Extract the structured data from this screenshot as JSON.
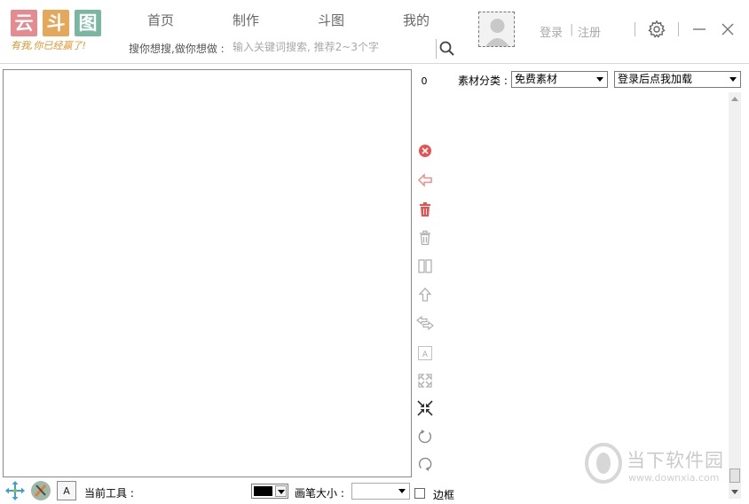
{
  "logo": {
    "chars": [
      "云",
      "斗",
      "图"
    ],
    "colors": [
      "#e58a8e",
      "#e5a85b",
      "#7ab7a3"
    ],
    "slogan": "有我,你已经赢了!"
  },
  "nav": {
    "tabs": [
      "首页",
      "制作",
      "斗图",
      "我的"
    ]
  },
  "search": {
    "label": "搜你想搜,做你想做 :",
    "placeholder": "输入关键词搜索, 推荐2~3个字",
    "icon": "search-icon"
  },
  "account": {
    "login": "登录",
    "separator": "|",
    "register": "注册"
  },
  "window_controls": {
    "settings_icon": "gear-icon",
    "minimize_icon": "minimize-icon",
    "close_icon": "close-icon"
  },
  "toolbar": {
    "count": "0",
    "tools": [
      {
        "name": "delete-red-icon",
        "color": "#e95050"
      },
      {
        "name": "undo-arrow-icon",
        "color": "#f08c8c"
      },
      {
        "name": "trash-red-icon",
        "color": "#e95050"
      },
      {
        "name": "trash-icon",
        "color": "#b0b0b0"
      },
      {
        "name": "split-icon",
        "color": "#b0b0b0"
      },
      {
        "name": "arrow-up-icon",
        "color": "#b0b0b0"
      },
      {
        "name": "swap-icon",
        "color": "#b0b0b0"
      },
      {
        "name": "text-box-icon",
        "color": "#b0b0b0"
      },
      {
        "name": "expand-icon",
        "color": "#b0b0b0"
      },
      {
        "name": "shrink-icon",
        "color": "#333333"
      },
      {
        "name": "rotate-right-icon",
        "color": "#8a8a8a"
      },
      {
        "name": "rotate-left-icon",
        "color": "#8a8a8a"
      }
    ]
  },
  "material": {
    "category_label": "素材分类 :",
    "category_value": "免费素材",
    "load_value": "登录后点我加载"
  },
  "bottom": {
    "move_icon": "move-arrows-icon",
    "brush_icon": "paint-brush-icon",
    "text_icon": "text-tool-icon",
    "text_icon_glyph": "A",
    "current_tool_label": "当前工具 :",
    "color_value": "#000000",
    "brush_size_label": "画笔大小 :",
    "brush_size_value": "",
    "border_label": "边框",
    "border_checked": false
  },
  "watermark": {
    "title": "当下软件园",
    "url": "www.downxia.com"
  }
}
